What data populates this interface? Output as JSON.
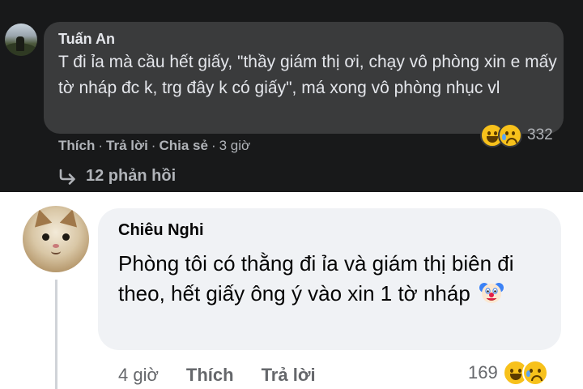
{
  "comment_1": {
    "author": "Tuấn An",
    "text": "T đi ỉa mà cầu hết giấy, \"thầy giám thị ơi, chạy vô phòng xin e mấy tờ nháp đc k, trg đây k có giấy\", má xong vô phòng nhục vl",
    "reaction_count": "332",
    "reactions": [
      "haha-icon",
      "sad-icon"
    ],
    "actions": {
      "like": "Thích",
      "reply": "Trả lời",
      "share": "Chia sẻ",
      "time": "3 giờ"
    },
    "replies_link": "12 phản hồi",
    "colors": {
      "background": "#18191a",
      "bubble": "#3a3b3c",
      "text": "#e4e6eb",
      "meta": "#b0b3b8"
    }
  },
  "comment_2": {
    "author": "Chiêu Nghi",
    "text": "Phòng tôi có thằng đi ỉa và giám thị biên đi theo, hết giấy ông ý vào xin 1 tờ nháp",
    "inline_emoji": "clown-face-icon",
    "reaction_count": "169",
    "reactions": [
      "haha-icon",
      "sad-icon"
    ],
    "actions": {
      "time": "4 giờ",
      "like": "Thích",
      "reply": "Trả lời"
    },
    "colors": {
      "background": "#ffffff",
      "bubble": "#f0f2f5",
      "text": "#050505",
      "meta": "#65676b"
    }
  }
}
